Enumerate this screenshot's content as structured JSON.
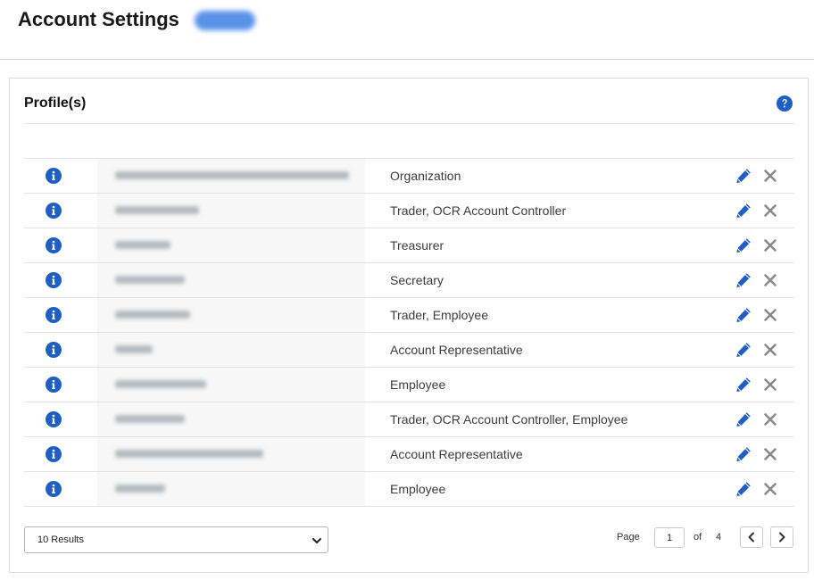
{
  "header": {
    "title": "Account Settings"
  },
  "panel": {
    "title": "Profile(s)",
    "rows": [
      {
        "role": "Organization"
      },
      {
        "role": "Trader, OCR Account Controller"
      },
      {
        "role": "Treasurer"
      },
      {
        "role": "Secretary"
      },
      {
        "role": "Trader, Employee"
      },
      {
        "role": "Account Representative"
      },
      {
        "role": "Employee"
      },
      {
        "role": "Trader, OCR Account Controller, Employee"
      },
      {
        "role": "Account Representative"
      },
      {
        "role": "Employee"
      }
    ]
  },
  "footer": {
    "results_selected": "10 Results",
    "page_label": "Page",
    "current_page": "1",
    "of_label": "of",
    "total_pages": "4"
  },
  "colors": {
    "accent": "#1f5fc4",
    "delete": "#8a8a8a"
  },
  "icons": {
    "info": "info-circle-icon",
    "edit": "pencil-icon",
    "delete": "close-icon",
    "help": "question-circle-icon"
  }
}
